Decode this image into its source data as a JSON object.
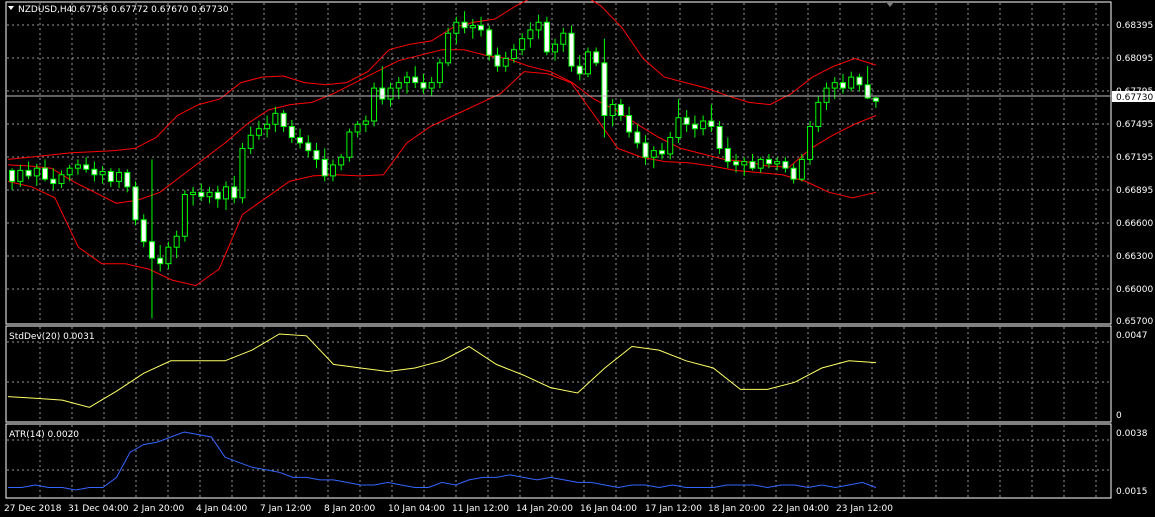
{
  "main_chart": {
    "symbol_label": "NZDUSD,H4",
    "ohlc": "0.67756 0.67772 0.67670 0.67730",
    "current_price": "0.67730",
    "price_labels": [
      "0.68395",
      "0.68095",
      "0.67795",
      "0.67495",
      "0.67195",
      "0.66895",
      "0.66600",
      "0.66300",
      "0.66000",
      "0.65700"
    ],
    "colors": {
      "background": "#000000",
      "grid": "#c0c0c0",
      "candle": "#00ff00",
      "bollinger": "#ff0000",
      "stddev": "#ffff66",
      "atr": "#3366ff",
      "axis": "#ffffff"
    }
  },
  "stddev_panel": {
    "label": "StdDev(20) 0.0031",
    "scale_labels": [
      "0.0047",
      "0"
    ]
  },
  "atr_panel": {
    "label": "ATR(14) 0.0020",
    "scale_labels": [
      "0.0038",
      "0.0015"
    ]
  },
  "time_labels": [
    "27 Dec 2018",
    "31 Dec 04:00",
    "2 Jan 20:00",
    "4 Jan 04:00",
    "7 Jan 12:00",
    "8 Jan 20:00",
    "10 Jan 04:00",
    "11 Jan 12:00",
    "14 Jan 20:00",
    "16 Jan 04:00",
    "17 Jan 12:00",
    "18 Jan 20:00",
    "22 Jan 04:00",
    "23 Jan 12:00"
  ],
  "chart_data": {
    "type": "candlestick",
    "candles_ohlc": [
      [
        0.671,
        0.6712,
        0.6692,
        0.67
      ],
      [
        0.67,
        0.6715,
        0.6695,
        0.671
      ],
      [
        0.671,
        0.6718,
        0.6702,
        0.6705
      ],
      [
        0.6705,
        0.6716,
        0.6696,
        0.6712
      ],
      [
        0.6712,
        0.672,
        0.67,
        0.6702
      ],
      [
        0.6702,
        0.6712,
        0.6692,
        0.6698
      ],
      [
        0.6698,
        0.671,
        0.6694,
        0.6706
      ],
      [
        0.6706,
        0.6715,
        0.67,
        0.6712
      ],
      [
        0.6712,
        0.672,
        0.6706,
        0.6715
      ],
      [
        0.6715,
        0.6722,
        0.6708,
        0.6711
      ],
      [
        0.6711,
        0.6718,
        0.67,
        0.6706
      ],
      [
        0.6706,
        0.6714,
        0.6698,
        0.6709
      ],
      [
        0.6709,
        0.6712,
        0.6695,
        0.67
      ],
      [
        0.67,
        0.6712,
        0.6694,
        0.6708
      ],
      [
        0.6708,
        0.6711,
        0.669,
        0.6695
      ],
      [
        0.6695,
        0.67,
        0.666,
        0.6665
      ],
      [
        0.6665,
        0.667,
        0.664,
        0.6645
      ],
      [
        0.6645,
        0.672,
        0.6575,
        0.663
      ],
      [
        0.663,
        0.6642,
        0.6618,
        0.6625
      ],
      [
        0.6625,
        0.6645,
        0.662,
        0.664
      ],
      [
        0.664,
        0.6655,
        0.663,
        0.665
      ],
      [
        0.665,
        0.6692,
        0.6645,
        0.6688
      ],
      [
        0.6688,
        0.6695,
        0.6678,
        0.669
      ],
      [
        0.669,
        0.6698,
        0.6682,
        0.6686
      ],
      [
        0.6686,
        0.6695,
        0.668,
        0.669
      ],
      [
        0.669,
        0.6696,
        0.6676,
        0.6684
      ],
      [
        0.6684,
        0.67,
        0.6674,
        0.6695
      ],
      [
        0.6695,
        0.6705,
        0.668,
        0.6685
      ],
      [
        0.6685,
        0.6735,
        0.668,
        0.673
      ],
      [
        0.673,
        0.675,
        0.6725,
        0.6742
      ],
      [
        0.6742,
        0.6755,
        0.6738,
        0.6748
      ],
      [
        0.6748,
        0.676,
        0.674,
        0.6752
      ],
      [
        0.6752,
        0.6768,
        0.6745,
        0.6762
      ],
      [
        0.6762,
        0.6765,
        0.6745,
        0.675
      ],
      [
        0.675,
        0.6756,
        0.6735,
        0.674
      ],
      [
        0.674,
        0.6748,
        0.673,
        0.6735
      ],
      [
        0.6735,
        0.6742,
        0.6722,
        0.6728
      ],
      [
        0.6728,
        0.6735,
        0.6712,
        0.672
      ],
      [
        0.672,
        0.673,
        0.67,
        0.6705
      ],
      [
        0.6705,
        0.672,
        0.67,
        0.6715
      ],
      [
        0.6715,
        0.6725,
        0.671,
        0.6722
      ],
      [
        0.6722,
        0.6748,
        0.6718,
        0.6745
      ],
      [
        0.6745,
        0.6755,
        0.674,
        0.6752
      ],
      [
        0.6752,
        0.676,
        0.6745,
        0.6755
      ],
      [
        0.6755,
        0.679,
        0.675,
        0.6785
      ],
      [
        0.6785,
        0.6805,
        0.677,
        0.6775
      ],
      [
        0.6775,
        0.679,
        0.6768,
        0.6785
      ],
      [
        0.6785,
        0.6795,
        0.6775,
        0.679
      ],
      [
        0.679,
        0.68,
        0.678,
        0.6795
      ],
      [
        0.6795,
        0.6805,
        0.6785,
        0.679
      ],
      [
        0.679,
        0.6798,
        0.678,
        0.6785
      ],
      [
        0.6785,
        0.6795,
        0.6778,
        0.679
      ],
      [
        0.679,
        0.6812,
        0.6785,
        0.6808
      ],
      [
        0.6808,
        0.684,
        0.6805,
        0.6835
      ],
      [
        0.6835,
        0.685,
        0.6825,
        0.6845
      ],
      [
        0.6845,
        0.6855,
        0.6835,
        0.684
      ],
      [
        0.684,
        0.6848,
        0.683,
        0.6842
      ],
      [
        0.6842,
        0.685,
        0.6832,
        0.6838
      ],
      [
        0.6838,
        0.6842,
        0.681,
        0.6815
      ],
      [
        0.6815,
        0.6822,
        0.68,
        0.6805
      ],
      [
        0.6805,
        0.6818,
        0.68,
        0.6812
      ],
      [
        0.6812,
        0.6825,
        0.6808,
        0.682
      ],
      [
        0.682,
        0.6835,
        0.6815,
        0.683
      ],
      [
        0.683,
        0.6845,
        0.6822,
        0.6838
      ],
      [
        0.6838,
        0.6852,
        0.683,
        0.6845
      ],
      [
        0.6845,
        0.685,
        0.6815,
        0.6818
      ],
      [
        0.6818,
        0.683,
        0.681,
        0.6825
      ],
      [
        0.6825,
        0.684,
        0.6818,
        0.6835
      ],
      [
        0.6835,
        0.6842,
        0.68,
        0.6805
      ],
      [
        0.6805,
        0.6815,
        0.6792,
        0.6798
      ],
      [
        0.6798,
        0.6822,
        0.6795,
        0.6818
      ],
      [
        0.6818,
        0.6822,
        0.6805,
        0.6808
      ],
      [
        0.6808,
        0.683,
        0.674,
        0.676
      ],
      [
        0.676,
        0.6775,
        0.675,
        0.677
      ],
      [
        0.677,
        0.6775,
        0.6755,
        0.676
      ],
      [
        0.676,
        0.6768,
        0.674,
        0.6745
      ],
      [
        0.6745,
        0.6752,
        0.673,
        0.6735
      ],
      [
        0.6735,
        0.6742,
        0.6715,
        0.6722
      ],
      [
        0.6722,
        0.6732,
        0.6712,
        0.6728
      ],
      [
        0.6728,
        0.6735,
        0.672,
        0.6725
      ],
      [
        0.6725,
        0.6745,
        0.672,
        0.674
      ],
      [
        0.674,
        0.6775,
        0.6735,
        0.6758
      ],
      [
        0.6758,
        0.6765,
        0.6745,
        0.6752
      ],
      [
        0.6752,
        0.676,
        0.674,
        0.6748
      ],
      [
        0.6748,
        0.676,
        0.6742,
        0.6755
      ],
      [
        0.6755,
        0.677,
        0.6745,
        0.675
      ],
      [
        0.675,
        0.6755,
        0.6725,
        0.673
      ],
      [
        0.673,
        0.674,
        0.6712,
        0.6718
      ],
      [
        0.6718,
        0.6725,
        0.6708,
        0.6715
      ],
      [
        0.6715,
        0.6722,
        0.6705,
        0.6718
      ],
      [
        0.6718,
        0.6725,
        0.671,
        0.6712
      ],
      [
        0.6712,
        0.6722,
        0.6708,
        0.672
      ],
      [
        0.672,
        0.6725,
        0.6712,
        0.6716
      ],
      [
        0.6716,
        0.6722,
        0.671,
        0.6718
      ],
      [
        0.6718,
        0.6722,
        0.6708,
        0.6712
      ],
      [
        0.6712,
        0.6716,
        0.6698,
        0.6702
      ],
      [
        0.6702,
        0.6725,
        0.67,
        0.672
      ],
      [
        0.672,
        0.6755,
        0.6715,
        0.675
      ],
      [
        0.675,
        0.6778,
        0.6745,
        0.6772
      ],
      [
        0.6772,
        0.679,
        0.6765,
        0.6785
      ],
      [
        0.6785,
        0.6795,
        0.6775,
        0.679
      ],
      [
        0.679,
        0.6798,
        0.678,
        0.6785
      ],
      [
        0.6785,
        0.68,
        0.6782,
        0.6795
      ],
      [
        0.6795,
        0.6798,
        0.6782,
        0.6788
      ],
      [
        0.6788,
        0.6805,
        0.6775,
        0.6776
      ],
      [
        0.6776,
        0.6777,
        0.6767,
        0.6773
      ]
    ],
    "bb_upper": [
      0.672,
      0.6722,
      0.6724,
      0.6726,
      0.6727,
      0.6728,
      0.673,
      0.674,
      0.676,
      0.677,
      0.6775,
      0.679,
      0.6795,
      0.6796,
      0.679,
      0.6788,
      0.679,
      0.68,
      0.682,
      0.6825,
      0.6828,
      0.684,
      0.6845,
      0.6848,
      0.686,
      0.687,
      0.6875,
      0.6872,
      0.686,
      0.684,
      0.6812,
      0.6795,
      0.679,
      0.6785,
      0.6778,
      0.6772,
      0.677,
      0.678,
      0.6795,
      0.6805,
      0.6812,
      0.6806
    ],
    "bb_middle": [
      0.6715,
      0.6714,
      0.6712,
      0.67,
      0.669,
      0.668,
      0.6683,
      0.669,
      0.6705,
      0.672,
      0.6735,
      0.6752,
      0.6765,
      0.677,
      0.6772,
      0.678,
      0.679,
      0.68,
      0.681,
      0.6815,
      0.682,
      0.682,
      0.6815,
      0.6812,
      0.6805,
      0.68,
      0.679,
      0.6775,
      0.6765,
      0.6752,
      0.674,
      0.673,
      0.6725,
      0.672,
      0.6718,
      0.6714,
      0.6713,
      0.673,
      0.6742,
      0.6752,
      0.676
    ],
    "bb_lower": [
      0.67,
      0.6695,
      0.6685,
      0.664,
      0.6625,
      0.6625,
      0.662,
      0.661,
      0.6605,
      0.662,
      0.667,
      0.6685,
      0.67,
      0.6705,
      0.6706,
      0.6705,
      0.6706,
      0.6735,
      0.675,
      0.676,
      0.677,
      0.678,
      0.68,
      0.6798,
      0.679,
      0.676,
      0.673,
      0.6722,
      0.6718,
      0.6717,
      0.6714,
      0.671,
      0.6708,
      0.6706,
      0.67,
      0.669,
      0.6685,
      0.669
    ],
    "stddev": [
      0.0012,
      0.0011,
      0.001,
      0.0006,
      0.0015,
      0.0025,
      0.0032,
      0.0032,
      0.0032,
      0.0038,
      0.0047,
      0.0046,
      0.003,
      0.0028,
      0.0026,
      0.0028,
      0.0032,
      0.004,
      0.003,
      0.0024,
      0.0017,
      0.0014,
      0.0028,
      0.004,
      0.0038,
      0.0032,
      0.0028,
      0.0016,
      0.0016,
      0.002,
      0.0028,
      0.0032,
      0.0031
    ],
    "atr": [
      0.0016,
      0.0016,
      0.0017,
      0.0016,
      0.0016,
      0.0015,
      0.0016,
      0.0016,
      0.002,
      0.003,
      0.0033,
      0.0034,
      0.0036,
      0.0038,
      0.0037,
      0.0036,
      0.0028,
      0.0026,
      0.0024,
      0.0023,
      0.0022,
      0.002,
      0.002,
      0.0019,
      0.0019,
      0.0018,
      0.0017,
      0.0017,
      0.0018,
      0.0017,
      0.0016,
      0.0016,
      0.0018,
      0.0017,
      0.0019,
      0.002,
      0.002,
      0.0021,
      0.002,
      0.0019,
      0.002,
      0.0019,
      0.0018,
      0.0018,
      0.0017,
      0.0016,
      0.0017,
      0.0017,
      0.0016,
      0.0017,
      0.0016,
      0.0016,
      0.0016,
      0.0017,
      0.0017,
      0.0017,
      0.0016,
      0.0017,
      0.0017,
      0.0016,
      0.0017,
      0.0016,
      0.0017,
      0.0018,
      0.0016
    ]
  }
}
